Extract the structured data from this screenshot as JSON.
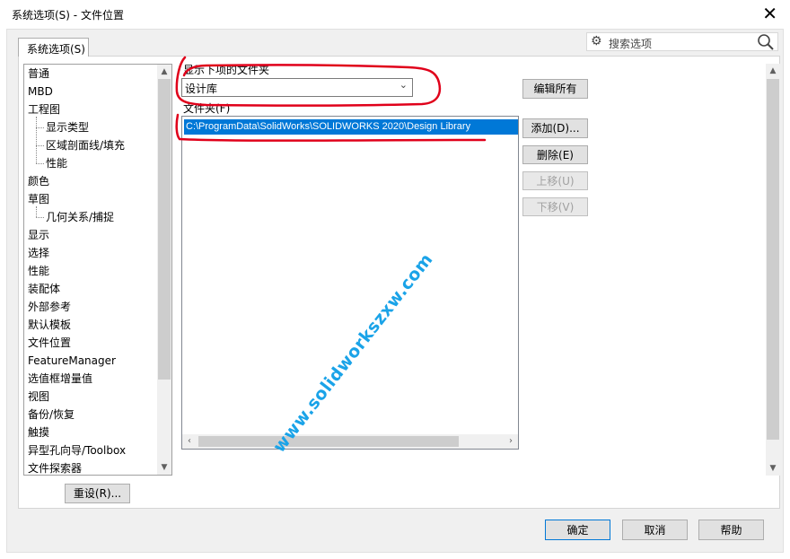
{
  "window": {
    "title": "系统选项(S) - 文件位置",
    "close_glyph": "✕"
  },
  "tab": {
    "label": "系统选项(S)"
  },
  "search": {
    "placeholder": "搜索选项"
  },
  "tree": {
    "items": [
      {
        "label": "普通",
        "level": 0
      },
      {
        "label": "MBD",
        "level": 0
      },
      {
        "label": "工程图",
        "level": 0
      },
      {
        "label": "显示类型",
        "level": 1
      },
      {
        "label": "区域剖面线/填充",
        "level": 1
      },
      {
        "label": "性能",
        "level": 1
      },
      {
        "label": "颜色",
        "level": 0
      },
      {
        "label": "草图",
        "level": 0
      },
      {
        "label": "几何关系/捕捉",
        "level": 1
      },
      {
        "label": "显示",
        "level": 0
      },
      {
        "label": "选择",
        "level": 0
      },
      {
        "label": "性能",
        "level": 0
      },
      {
        "label": "装配体",
        "level": 0
      },
      {
        "label": "外部参考",
        "level": 0
      },
      {
        "label": "默认模板",
        "level": 0
      },
      {
        "label": "文件位置",
        "level": 0
      },
      {
        "label": "FeatureManager",
        "level": 0
      },
      {
        "label": "选值框增量值",
        "level": 0
      },
      {
        "label": "视图",
        "level": 0
      },
      {
        "label": "备份/恢复",
        "level": 0
      },
      {
        "label": "触摸",
        "level": 0
      },
      {
        "label": "异型孔向导/Toolbox",
        "level": 0
      },
      {
        "label": "文件探索器",
        "level": 0
      }
    ],
    "scroll_up": "▲",
    "scroll_down": "▼"
  },
  "reset_button": "重设(R)...",
  "folders_for": {
    "label": "显示下项的文件夹",
    "selected": "设计库",
    "chevron": "⌄"
  },
  "folders": {
    "label": "文件夹(F)",
    "rows": [
      "C:\\ProgramData\\SolidWorks\\SOLIDWORKS 2020\\Design Library"
    ],
    "scroll_left": "‹",
    "scroll_right": "›"
  },
  "buttons": {
    "edit_all": "编辑所有",
    "add": "添加(D)...",
    "delete": "删除(E)",
    "move_up": "上移(U)",
    "move_down": "下移(V)"
  },
  "footer": {
    "ok": "确定",
    "cancel": "取消",
    "help": "帮助"
  },
  "watermark": "www.solidworkszxw.com",
  "colors": {
    "selection": "#0078d7",
    "annotation": "#e0001a",
    "watermark": "#1aa3e8"
  }
}
